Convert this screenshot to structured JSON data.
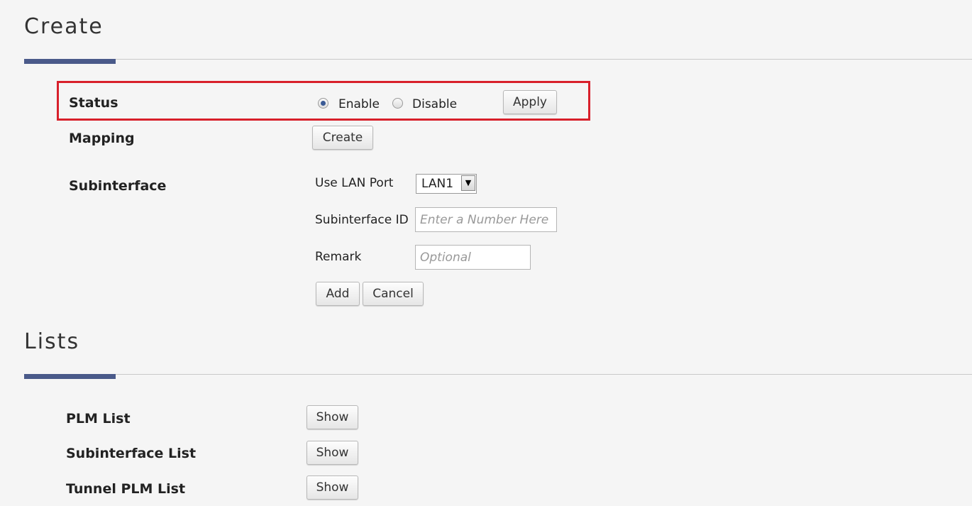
{
  "create_section": {
    "title": "Create",
    "status": {
      "label": "Status",
      "options": [
        "Enable",
        "Disable"
      ],
      "selected": "Enable",
      "apply_label": "Apply"
    },
    "mapping": {
      "label": "Mapping",
      "create_label": "Create"
    },
    "subinterface": {
      "label": "Subinterface",
      "lan_port_label": "Use LAN Port",
      "lan_port_value": "LAN1",
      "id_label": "Subinterface ID",
      "id_placeholder": "Enter a Number Here",
      "remark_label": "Remark",
      "remark_placeholder": "Optional",
      "add_label": "Add",
      "cancel_label": "Cancel"
    }
  },
  "lists_section": {
    "title": "Lists",
    "items": [
      {
        "label": "PLM List",
        "button": "Show"
      },
      {
        "label": "Subinterface List",
        "button": "Show"
      },
      {
        "label": "Tunnel PLM List",
        "button": "Show"
      }
    ]
  },
  "colors": {
    "accent": "#4a5a8a",
    "highlight": "#d8202b",
    "background": "#f5f5f5"
  }
}
